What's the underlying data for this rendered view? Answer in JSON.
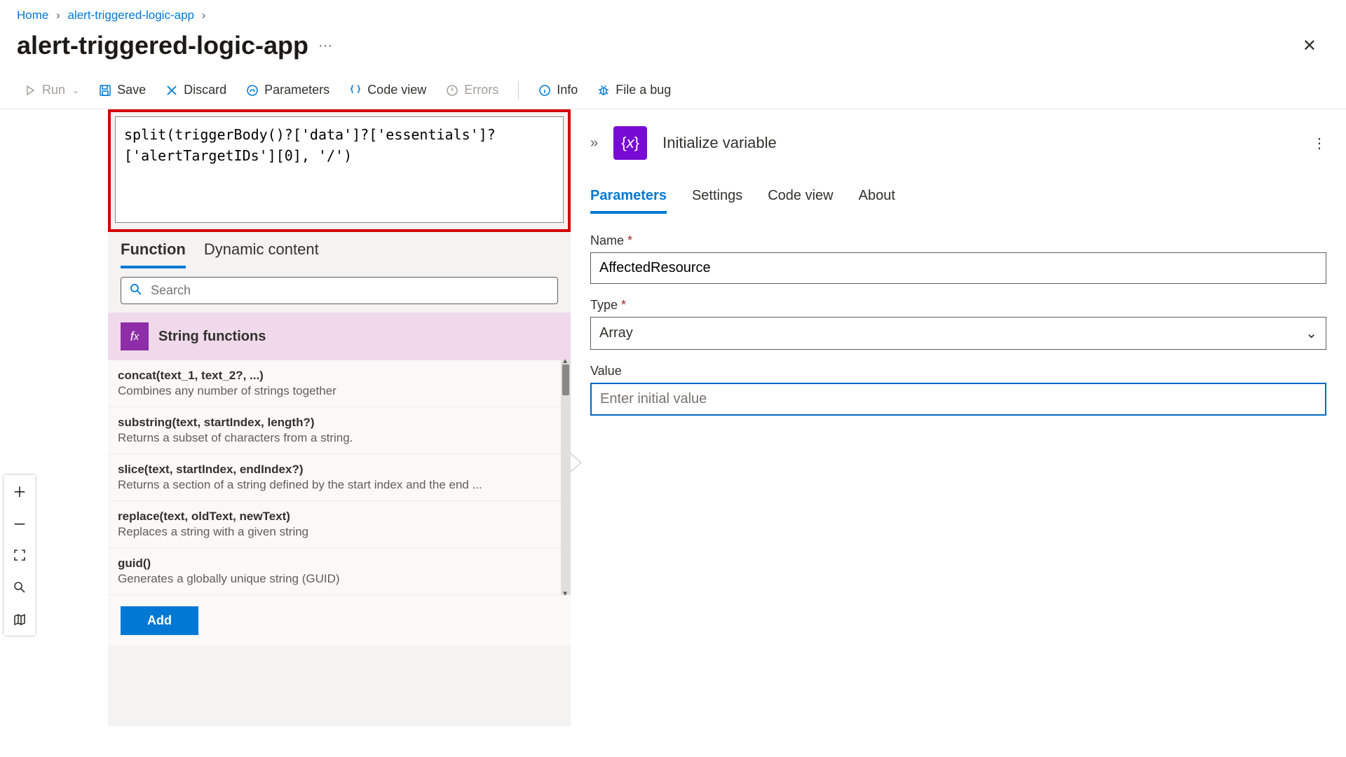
{
  "breadcrumb": {
    "home": "Home",
    "app": "alert-triggered-logic-app"
  },
  "title": "alert-triggered-logic-app",
  "toolbar": {
    "run": "Run",
    "save": "Save",
    "discard": "Discard",
    "parameters": "Parameters",
    "codeview": "Code view",
    "errors": "Errors",
    "info": "Info",
    "fileabug": "File a bug"
  },
  "expression": {
    "value": "split(triggerBody()?['data']?['essentials']?['alertTargetIDs'][0], '/')",
    "tabs": {
      "function": "Function",
      "dynamic": "Dynamic content"
    },
    "search_placeholder": "Search",
    "category": "String functions",
    "functions": [
      {
        "sig": "concat(text_1, text_2?, ...)",
        "desc": "Combines any number of strings together"
      },
      {
        "sig": "substring(text, startIndex, length?)",
        "desc": "Returns a subset of characters from a string."
      },
      {
        "sig": "slice(text, startIndex, endIndex?)",
        "desc": "Returns a section of a string defined by the start index and the end ..."
      },
      {
        "sig": "replace(text, oldText, newText)",
        "desc": "Replaces a string with a given string"
      },
      {
        "sig": "guid()",
        "desc": "Generates a globally unique string (GUID)"
      }
    ],
    "add": "Add"
  },
  "action": {
    "title": "Initialize variable",
    "tabs": {
      "parameters": "Parameters",
      "settings": "Settings",
      "codeview": "Code view",
      "about": "About"
    },
    "name_label": "Name",
    "name_value": "AffectedResource",
    "type_label": "Type",
    "type_value": "Array",
    "value_label": "Value",
    "value_placeholder": "Enter initial value"
  }
}
